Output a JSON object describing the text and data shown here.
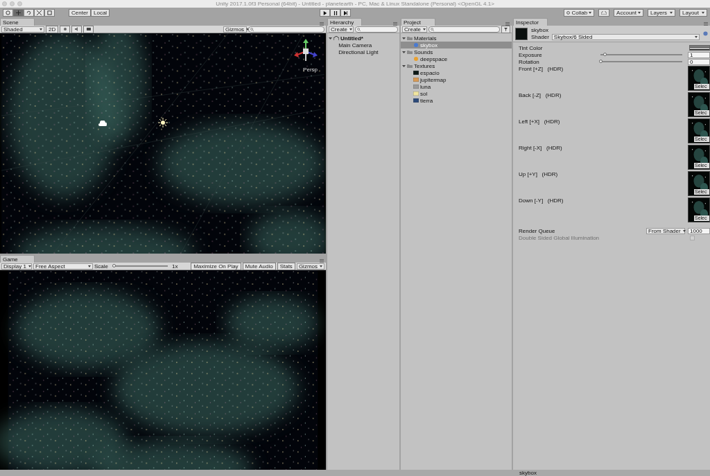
{
  "window": {
    "title": "Unity 2017.1.0f3 Personal (64bit) - Untitled - planetearth - PC, Mac & Linux Standalone (Personal) <OpenGL 4.1>"
  },
  "toolbar": {
    "tools": [
      {
        "kind": "hand",
        "selected": false
      },
      {
        "kind": "move",
        "selected": true
      },
      {
        "kind": "rotate",
        "selected": false
      },
      {
        "kind": "scale",
        "selected": false
      },
      {
        "kind": "rect",
        "selected": false
      }
    ],
    "pivot": [
      "Center",
      "Local"
    ],
    "play": [
      {
        "kind": "play"
      },
      {
        "kind": "pause"
      },
      {
        "kind": "step"
      }
    ],
    "dropdowns": [
      {
        "label": "Collab",
        "kind": "collab"
      },
      {
        "kind": "cloud"
      },
      {
        "label": "Account",
        "kind": "plain"
      },
      {
        "label": "Layers",
        "kind": "plain"
      },
      {
        "label": "Layout",
        "kind": "plain"
      }
    ]
  },
  "scene": {
    "tab": "Scene",
    "shading": "Shaded",
    "mode_2d": "2D",
    "toggles": [
      {
        "kind": "lighting",
        "on": false
      },
      {
        "kind": "audio",
        "on": false
      },
      {
        "kind": "effects",
        "on": false
      }
    ],
    "gizmos": "Gizmos",
    "persp": "Persp"
  },
  "game": {
    "tab": "Game",
    "display": "Display 1",
    "aspect": "Free Aspect",
    "scale_label": "Scale",
    "scale": {
      "level": 0.02
    },
    "scale_value": "1x",
    "toggles": [
      "Maximize On Play",
      "Mute Audio",
      "Stats",
      "Gizmos"
    ]
  },
  "hierarchy": {
    "tab": "Hierarchy",
    "create": "Create",
    "items": [
      {
        "label": "Untitled*",
        "kind": "scene",
        "expanded": true,
        "selected": false,
        "children": [
          {
            "label": "Main Camera",
            "selected": false
          },
          {
            "label": "Directional Light",
            "selected": false
          }
        ]
      }
    ]
  },
  "project": {
    "tab": "Project",
    "create": "Create",
    "items": [
      {
        "label": "Materials",
        "kind": "folder",
        "expanded": true,
        "selected": false,
        "children": [
          {
            "label": "skybox",
            "kind": "material",
            "selected": true
          }
        ]
      },
      {
        "label": "Sounds",
        "kind": "folder",
        "expanded": true,
        "selected": false,
        "children": [
          {
            "label": "deepspace",
            "kind": "audio",
            "selected": false
          }
        ]
      },
      {
        "label": "Textures",
        "kind": "folder",
        "expanded": true,
        "selected": false,
        "children": [
          {
            "label": "espacio",
            "kind": "texture",
            "color": "#0e1a17",
            "selected": false
          },
          {
            "label": "jupitermap",
            "kind": "texture",
            "color": "#d89a55",
            "selected": false
          },
          {
            "label": "luna",
            "kind": "texture",
            "color": "#9a9a9a",
            "selected": false
          },
          {
            "label": "sol",
            "kind": "texture",
            "color": "#f2e6a0",
            "selected": false
          },
          {
            "label": "tierra",
            "kind": "texture",
            "color": "#2c4a7a",
            "selected": false
          }
        ]
      }
    ]
  },
  "inspector": {
    "tab": "Inspector",
    "name": "skybox",
    "shader_label": "Shader",
    "shader": "Skybox/6 Sided",
    "properties": [
      {
        "kind": "color",
        "label": "Tint Color"
      },
      {
        "kind": "slider",
        "label": "Exposure",
        "level": 0.05,
        "value": "1"
      },
      {
        "kind": "slider",
        "label": "Rotation",
        "level": 0,
        "value": "0"
      },
      {
        "kind": "texture",
        "label": "Front [+Z]   (HDR)",
        "button": "Selec"
      },
      {
        "kind": "texture",
        "label": "Back [-Z]   (HDR)",
        "button": "Selec"
      },
      {
        "kind": "texture",
        "label": "Left [+X]   (HDR)",
        "button": "Selec"
      },
      {
        "kind": "texture",
        "label": "Right [-X]   (HDR)",
        "button": "Selec"
      },
      {
        "kind": "texture",
        "label": "Up [+Y]   (HDR)",
        "button": "Selec"
      },
      {
        "kind": "texture",
        "label": "Down [-Y]   (HDR)",
        "button": "Selec"
      },
      {
        "kind": "queue",
        "label": "Render Queue",
        "option": "From Shader",
        "value": "1000"
      },
      {
        "kind": "check",
        "label": "Double Sided Global Illumination",
        "disabled": true,
        "checked": false
      }
    ]
  },
  "status_bar": {
    "text": "skybox"
  }
}
